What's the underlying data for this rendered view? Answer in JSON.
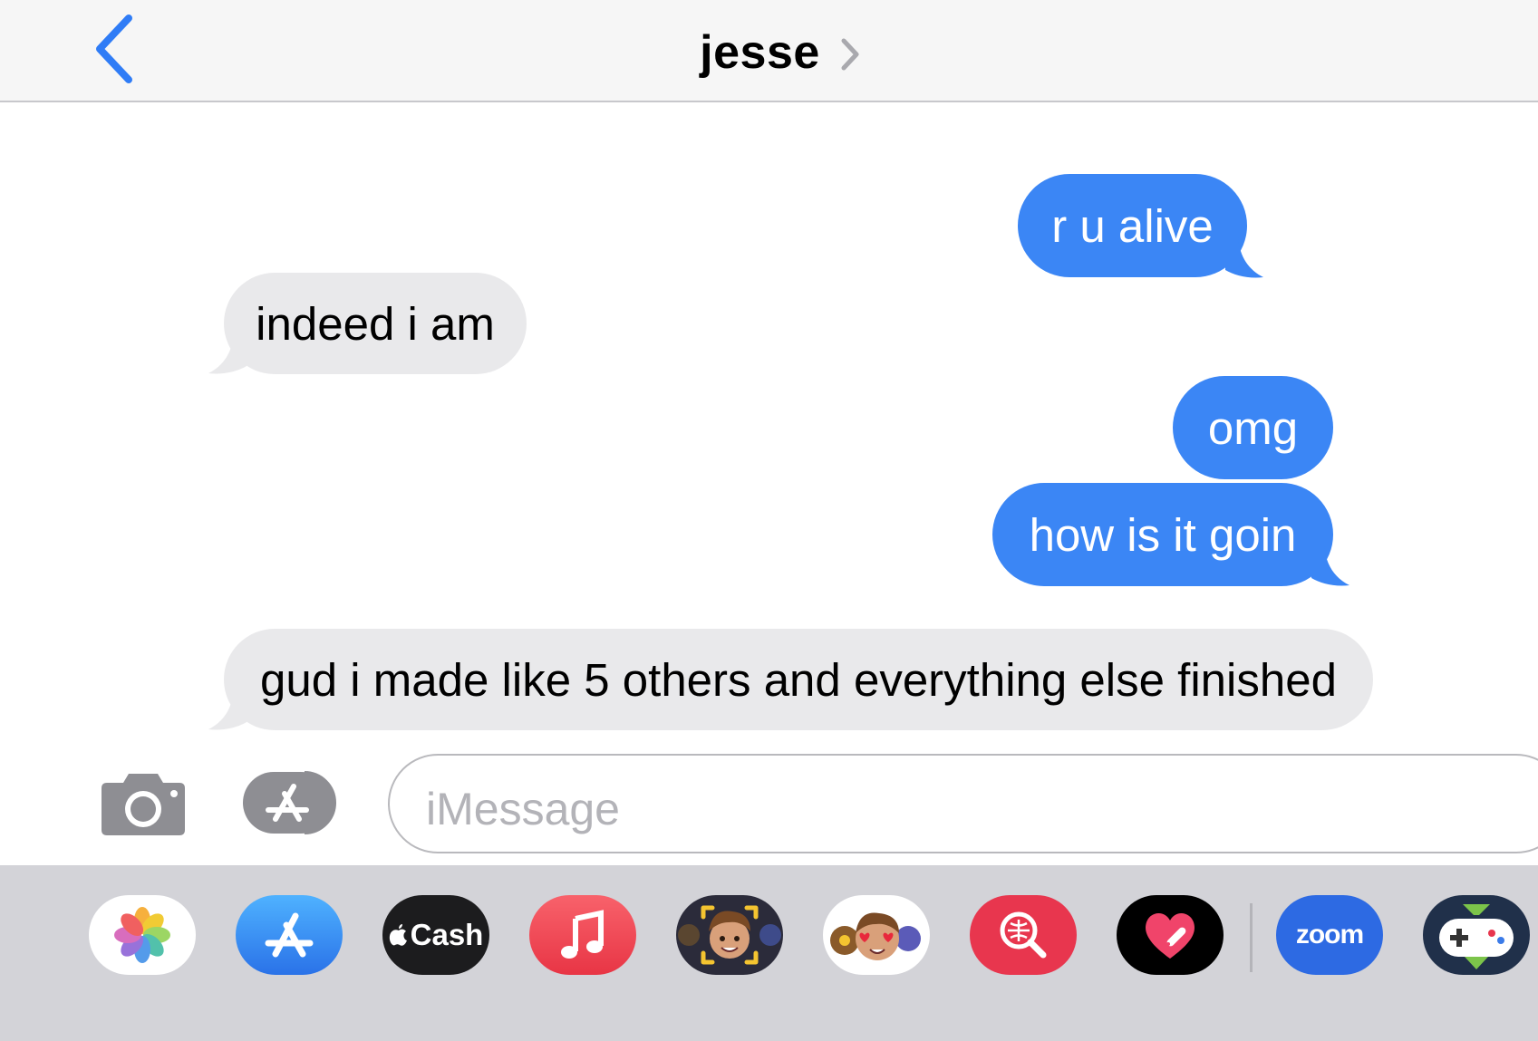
{
  "header": {
    "title": "jesse"
  },
  "messages": [
    {
      "text": "r u alive",
      "from": "me"
    },
    {
      "text": "indeed i am",
      "from": "jesse"
    },
    {
      "text": "omg",
      "from": "me"
    },
    {
      "text": "how is it goin",
      "from": "me"
    },
    {
      "text": "gud i made like 5 others and everything else finished",
      "from": "jesse"
    }
  ],
  "composer": {
    "placeholder": "iMessage"
  },
  "app_drawer": {
    "apps": [
      {
        "name": "Photos",
        "icon": "photos-icon"
      },
      {
        "name": "App Store",
        "icon": "app-store-icon"
      },
      {
        "name": "Apple Cash",
        "label": "Cash",
        "icon": "apple-cash-icon"
      },
      {
        "name": "Music",
        "icon": "music-icon"
      },
      {
        "name": "Memoji",
        "icon": "memoji-icon"
      },
      {
        "name": "Memoji Stickers",
        "icon": "memoji-stickers-icon"
      },
      {
        "name": "Images Search",
        "icon": "image-search-icon"
      },
      {
        "name": "Digital Touch",
        "icon": "digital-touch-icon"
      },
      {
        "name": "Zoom",
        "label": "zoom",
        "icon": "zoom-icon"
      },
      {
        "name": "Game Pigeon",
        "icon": "game-icon"
      }
    ]
  },
  "colors": {
    "sent_bubble": "#3b86f5",
    "received_bubble": "#e9e9eb",
    "accent": "#2f7cf6",
    "drawer_bg": "#d3d3d8"
  }
}
